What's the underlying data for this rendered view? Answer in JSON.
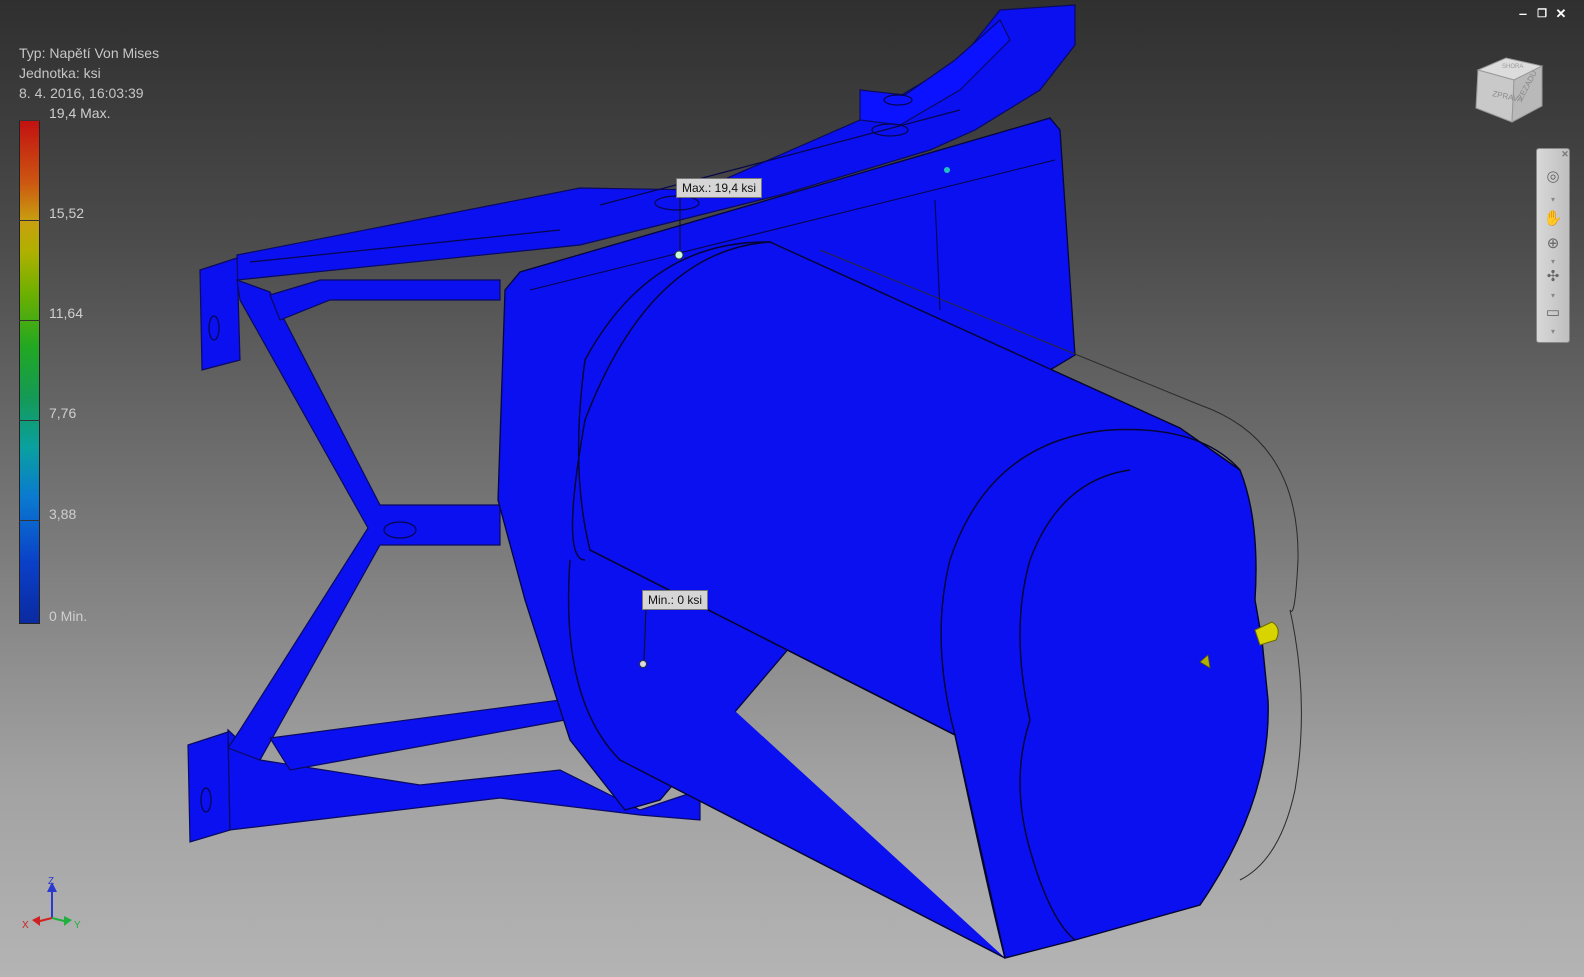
{
  "legend": {
    "type_line": "Typ: Napětí Von Mises",
    "unit_line": "Jednotka: ksi",
    "date_line": "8. 4. 2016, 16:03:39",
    "ticks": [
      "19,4 Max.",
      "15,52",
      "11,64",
      "7,76",
      "3,88",
      "0 Min."
    ]
  },
  "probes": {
    "max": "Max.: 19,4 ksi",
    "min": "Min.: 0 ksi"
  },
  "window_controls": {
    "minimize": "‒",
    "restore": "❐",
    "close": "✕"
  },
  "viewcube": {
    "face_right": "ZPRAVA",
    "face_back": "ZEZADU",
    "face_top": "SHORA"
  },
  "triad": {
    "x": "X",
    "y": "Y",
    "z": "Z"
  },
  "colors": {
    "model": "#0a10f0",
    "max_color": "#c21111",
    "min_color": "#0a2aa0"
  }
}
